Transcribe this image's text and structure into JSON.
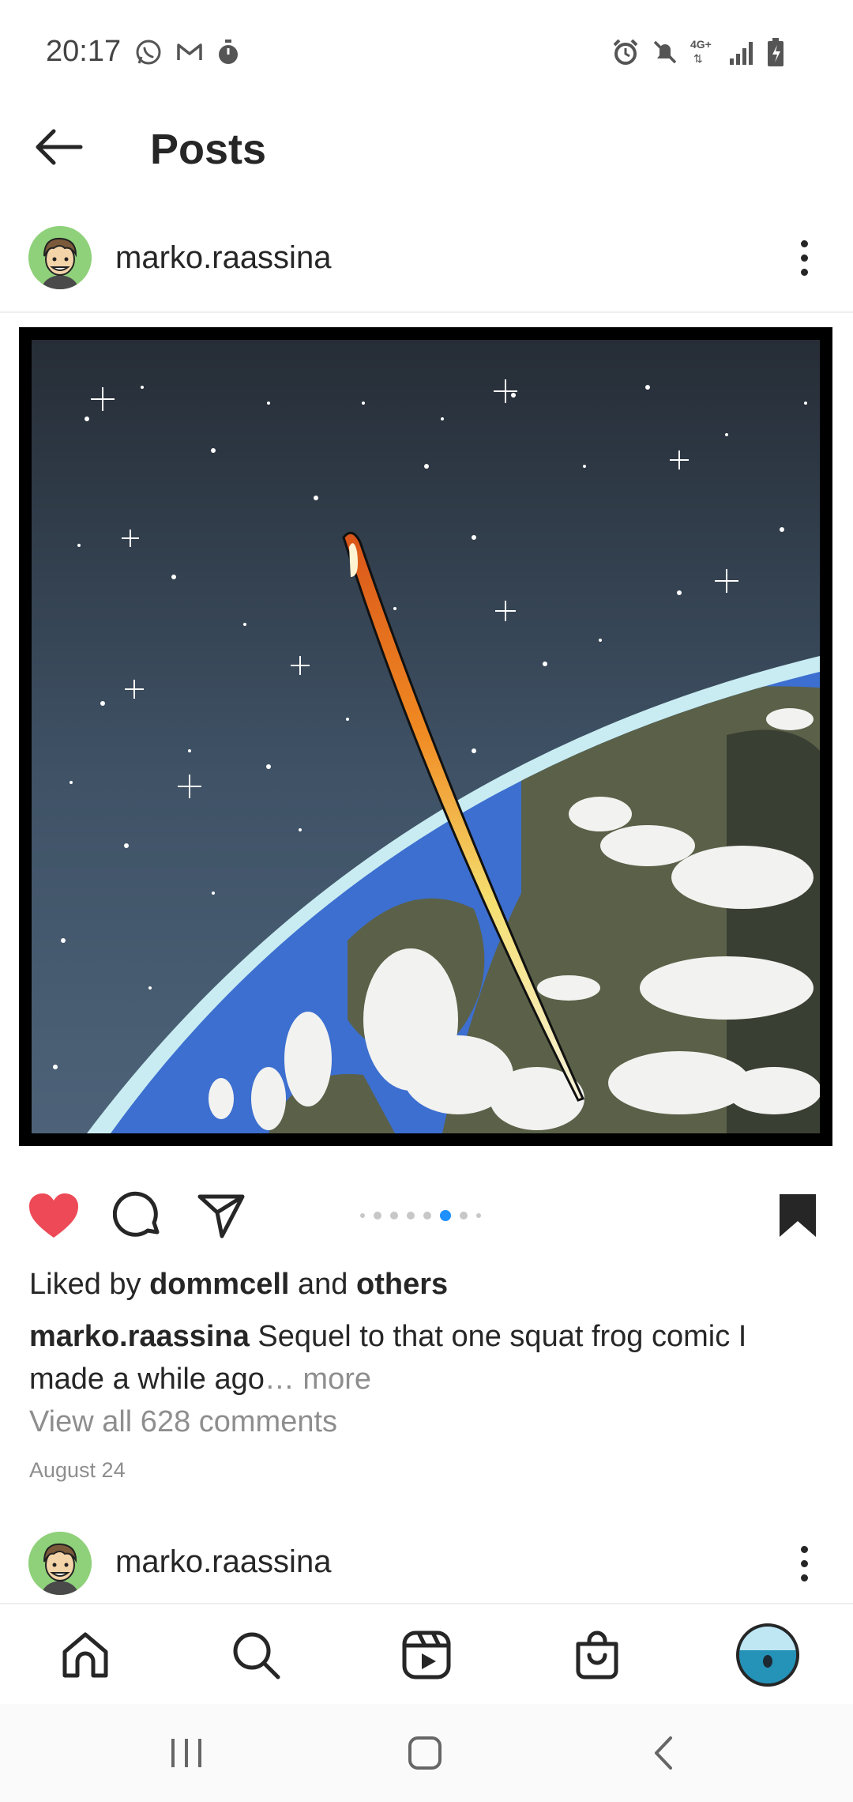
{
  "status_bar": {
    "time": "20:17",
    "left_icons": [
      "whatsapp-icon",
      "gmail-icon",
      "timer-icon"
    ],
    "right_icons": [
      "alarm-icon",
      "mute-icon",
      "network-4g-icon",
      "signal-icon",
      "battery-icon"
    ],
    "network_label": "4G+"
  },
  "header": {
    "title": "Posts"
  },
  "post": {
    "username": "marko.raassina",
    "image_description_icon": "comic-earth-meteor",
    "carousel": {
      "total": 8,
      "active_index": 5
    },
    "liked_by_prefix": "Liked by ",
    "liked_by_user": "dommcell",
    "liked_by_middle": " and ",
    "liked_by_others": "others",
    "caption_user": "marko.raassina",
    "caption_text": " Sequel to that one squat frog comic I made a while ago",
    "caption_more": "… more",
    "comments_link": "View all 628 comments",
    "date": "August 24",
    "liked": true,
    "saved": true
  },
  "next_post": {
    "username": "marko.raassina"
  },
  "bottom_nav": [
    "home-icon",
    "search-icon",
    "reels-icon",
    "shop-icon",
    "profile-avatar"
  ],
  "colors": {
    "like": "#ed4956",
    "active_dot": "#1e90ff",
    "muted_text": "#8e8e8e",
    "text": "#262626"
  }
}
